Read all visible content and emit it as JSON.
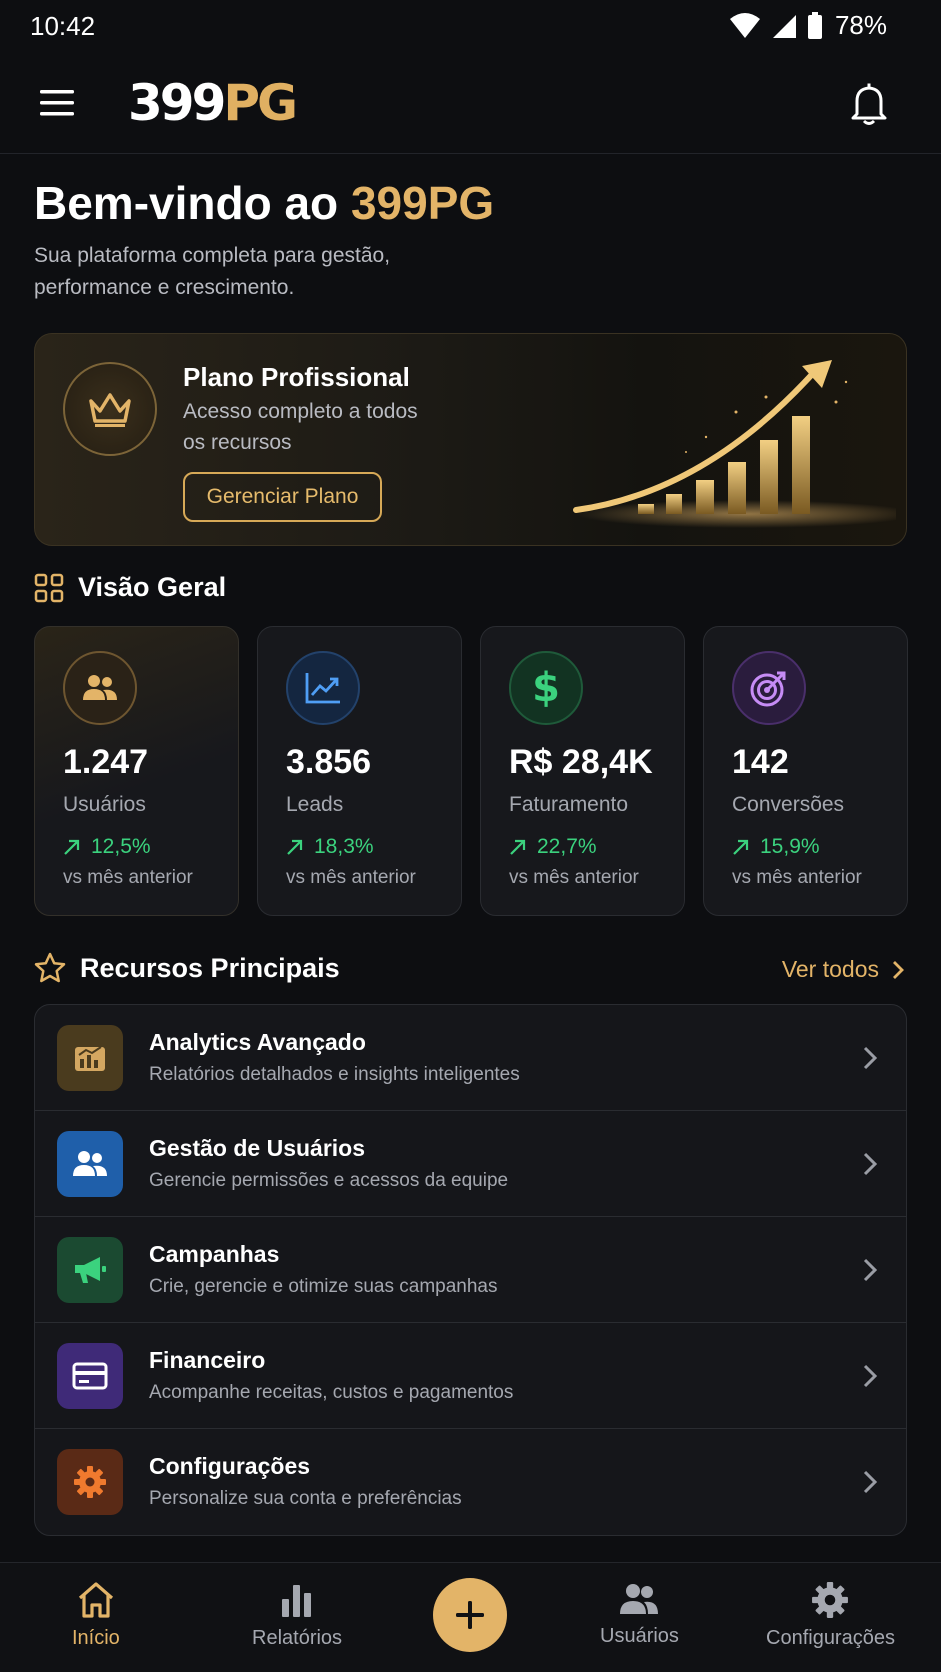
{
  "status_bar": {
    "time": "10:42",
    "battery": "78%"
  },
  "header": {
    "logo_white": "399",
    "logo_gold": "PG"
  },
  "welcome": {
    "title_prefix": "Bem-vindo ao ",
    "title_brand_white": "399",
    "title_brand_gold": "PG",
    "subtitle": "Sua plataforma completa para gestão, performance e crescimento."
  },
  "plan": {
    "title": "Plano Profissional",
    "description": "Acesso completo a todos os recursos",
    "button_label": "Gerenciar Plano"
  },
  "overview": {
    "title": "Visão Geral",
    "stats": [
      {
        "value": "1.247",
        "label": "Usuários",
        "change": "12,5%",
        "period": "vs mês anterior",
        "icon": "users-icon",
        "color": "#e3b468"
      },
      {
        "value": "3.856",
        "label": "Leads",
        "change": "18,3%",
        "period": "vs mês anterior",
        "icon": "trending-up-icon",
        "color": "#4f9ef5"
      },
      {
        "value": "R$ 28,4K",
        "label": "Faturamento",
        "change": "22,7%",
        "period": "vs mês anterior",
        "icon": "dollar-icon",
        "color": "#3bd27e"
      },
      {
        "value": "142",
        "label": "Conversões",
        "change": "15,9%",
        "period": "vs mês anterior",
        "icon": "target-icon",
        "color": "#c68cf5"
      }
    ]
  },
  "resources": {
    "title": "Recursos Principais",
    "view_all": "Ver todos",
    "items": [
      {
        "title": "Analytics Avançado",
        "description": "Relatórios detalhados e insights inteligentes",
        "icon": "analytics-icon",
        "color": "#e3b468"
      },
      {
        "title": "Gestão de Usuários",
        "description": "Gerencie permissões e acessos da equipe",
        "icon": "users-icon",
        "color": "#2f7fd6"
      },
      {
        "title": "Campanhas",
        "description": "Crie, gerencie e otimize suas campanhas",
        "icon": "megaphone-icon",
        "color": "#3bd27e"
      },
      {
        "title": "Financeiro",
        "description": "Acompanhe receitas, custos e pagamentos",
        "icon": "credit-card-icon",
        "color": "#8a63e6"
      },
      {
        "title": "Configurações",
        "description": "Personalize sua conta e preferências",
        "icon": "gear-icon",
        "color": "#f07a2e"
      }
    ]
  },
  "bottom_nav": {
    "items": [
      {
        "label": "Início",
        "icon": "home-icon",
        "active": true
      },
      {
        "label": "Relatórios",
        "icon": "bar-chart-icon",
        "active": false
      },
      {
        "label": "Usuários",
        "icon": "users-icon",
        "active": false
      },
      {
        "label": "Configurações",
        "icon": "gear-icon",
        "active": false
      }
    ],
    "fab_icon": "plus-icon"
  },
  "colors": {
    "accent": "#e3b468",
    "background": "#0d0e11",
    "card": "#17181c",
    "positive": "#3bd27e"
  }
}
